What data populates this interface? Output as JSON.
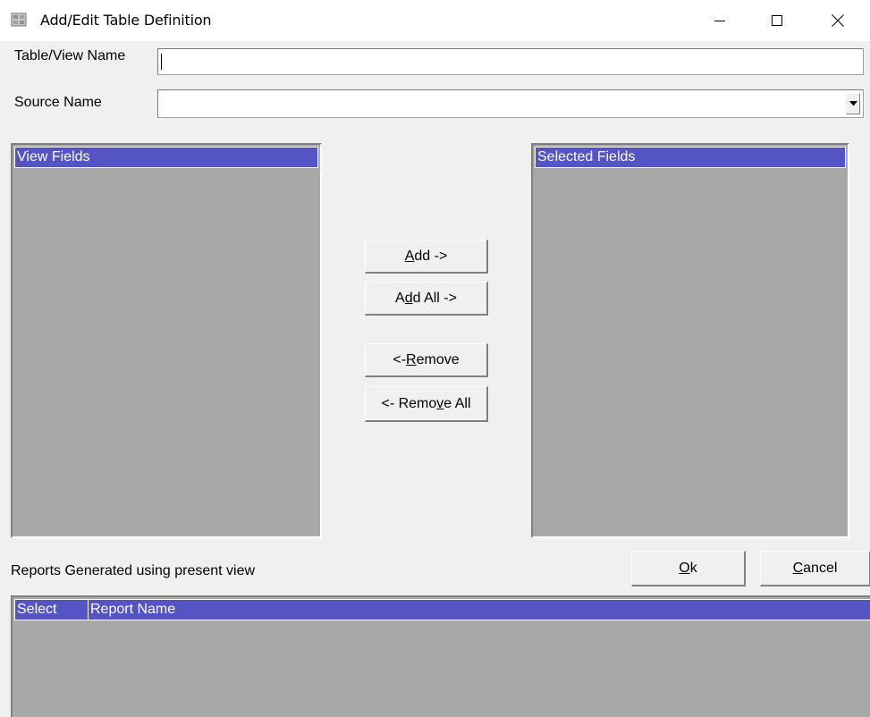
{
  "window": {
    "title": "Add/Edit Table Definition"
  },
  "form": {
    "table_view_label": "Table/View Name",
    "table_view_value": "",
    "source_label": "Source Name",
    "source_value": ""
  },
  "view_fields": {
    "header": "View Fields",
    "items": []
  },
  "selected_fields": {
    "header": "Selected Fields",
    "items": []
  },
  "buttons": {
    "add": {
      "before": "",
      "mnemonic": "A",
      "after": "dd ->"
    },
    "add_all": {
      "before": "A",
      "mnemonic": "d",
      "after": "d All ->"
    },
    "remove": {
      "before": "<- ",
      "mnemonic": "R",
      "after": "emove"
    },
    "remove_all": {
      "before": "<- Remo",
      "mnemonic": "v",
      "after": "e All"
    },
    "ok": {
      "before": "",
      "mnemonic": "O",
      "after": "k"
    },
    "cancel": {
      "before": "",
      "mnemonic": "C",
      "after": "ancel"
    }
  },
  "reports": {
    "label": "Reports Generated using present view",
    "columns": [
      "Select",
      "Report Name"
    ],
    "rows": []
  }
}
